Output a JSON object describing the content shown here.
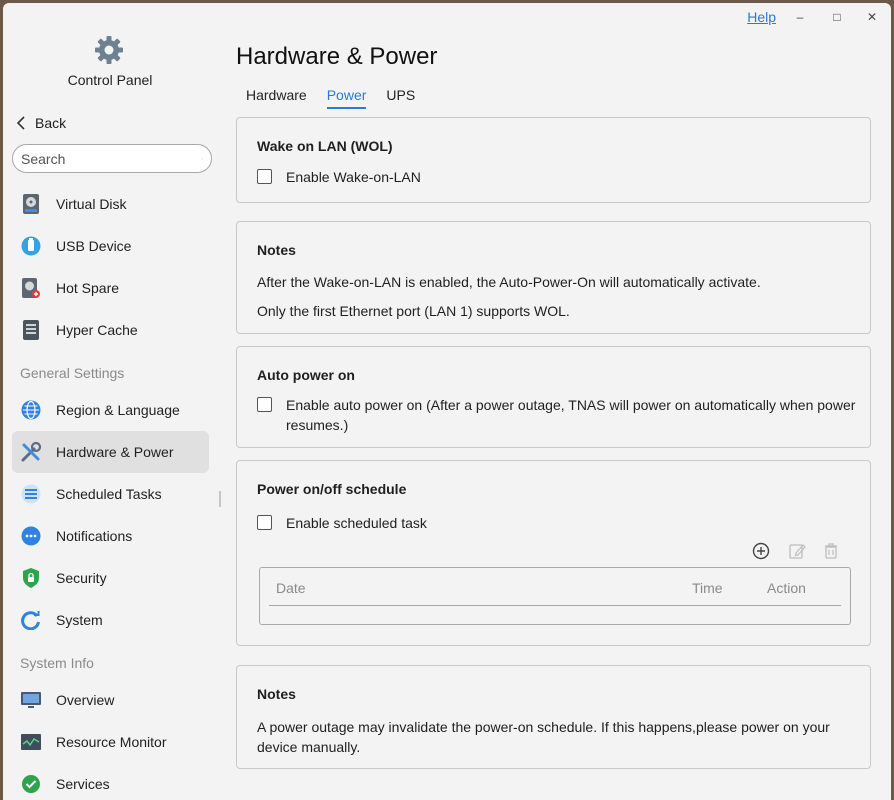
{
  "titlebar": {
    "help_label": "Help",
    "minimize_glyph": "–",
    "maximize_glyph": "□",
    "close_glyph": "✕"
  },
  "sidebar": {
    "app_icon": "gear-icon",
    "app_title": "Control Panel",
    "back_label": "Back",
    "search_placeholder": "Search",
    "items": [
      {
        "label": "Virtual Disk",
        "icon": "virtual-disk-icon"
      },
      {
        "label": "USB Device",
        "icon": "usb-icon"
      },
      {
        "label": "Hot Spare",
        "icon": "hot-spare-icon"
      },
      {
        "label": "Hyper Cache",
        "icon": "hyper-cache-icon"
      }
    ],
    "section_general": "General Settings",
    "general_items": [
      {
        "label": "Region & Language",
        "icon": "globe-icon"
      },
      {
        "label": "Hardware & Power",
        "icon": "tools-icon",
        "active": true
      },
      {
        "label": "Scheduled Tasks",
        "icon": "tasks-icon"
      },
      {
        "label": "Notifications",
        "icon": "chat-bubble-icon"
      },
      {
        "label": "Security",
        "icon": "shield-lock-icon"
      },
      {
        "label": "System",
        "icon": "system-refresh-icon"
      }
    ],
    "section_info": "System Info",
    "info_items": [
      {
        "label": "Overview",
        "icon": "monitor-icon"
      },
      {
        "label": "Resource Monitor",
        "icon": "resource-monitor-icon"
      },
      {
        "label": "Services",
        "icon": "services-check-icon"
      }
    ]
  },
  "main": {
    "title": "Hardware & Power",
    "tabs": [
      {
        "label": "Hardware",
        "active": false
      },
      {
        "label": "Power",
        "active": true
      },
      {
        "label": "UPS",
        "active": false
      }
    ],
    "wol": {
      "title": "Wake on LAN (WOL)",
      "checkbox_label": "Enable Wake-on-LAN",
      "checked": false
    },
    "notes1": {
      "title": "Notes",
      "line1": "After the Wake-on-LAN is enabled, the Auto-Power-On will automatically activate.",
      "line2": "Only the first Ethernet port (LAN 1) supports WOL."
    },
    "auto_power": {
      "title": "Auto power on",
      "checkbox_label": "Enable auto power on (After a power outage, TNAS will power on automatically when power resumes.)",
      "checked": false
    },
    "schedule": {
      "title": "Power on/off schedule",
      "checkbox_label": "Enable scheduled task",
      "checked": false,
      "toolbar_icons": [
        "add-circle-icon",
        "edit-icon",
        "trash-icon"
      ],
      "columns": {
        "date": "Date",
        "time": "Time",
        "action": "Action"
      },
      "rows": []
    },
    "notes2": {
      "title": "Notes",
      "text": "A power outage may invalidate the power-on schedule. If this happens,please power on your device manually."
    }
  },
  "colors": {
    "accent": "#2a7ad6",
    "background": "#f3f3f3",
    "border": "#c9c9c9"
  }
}
